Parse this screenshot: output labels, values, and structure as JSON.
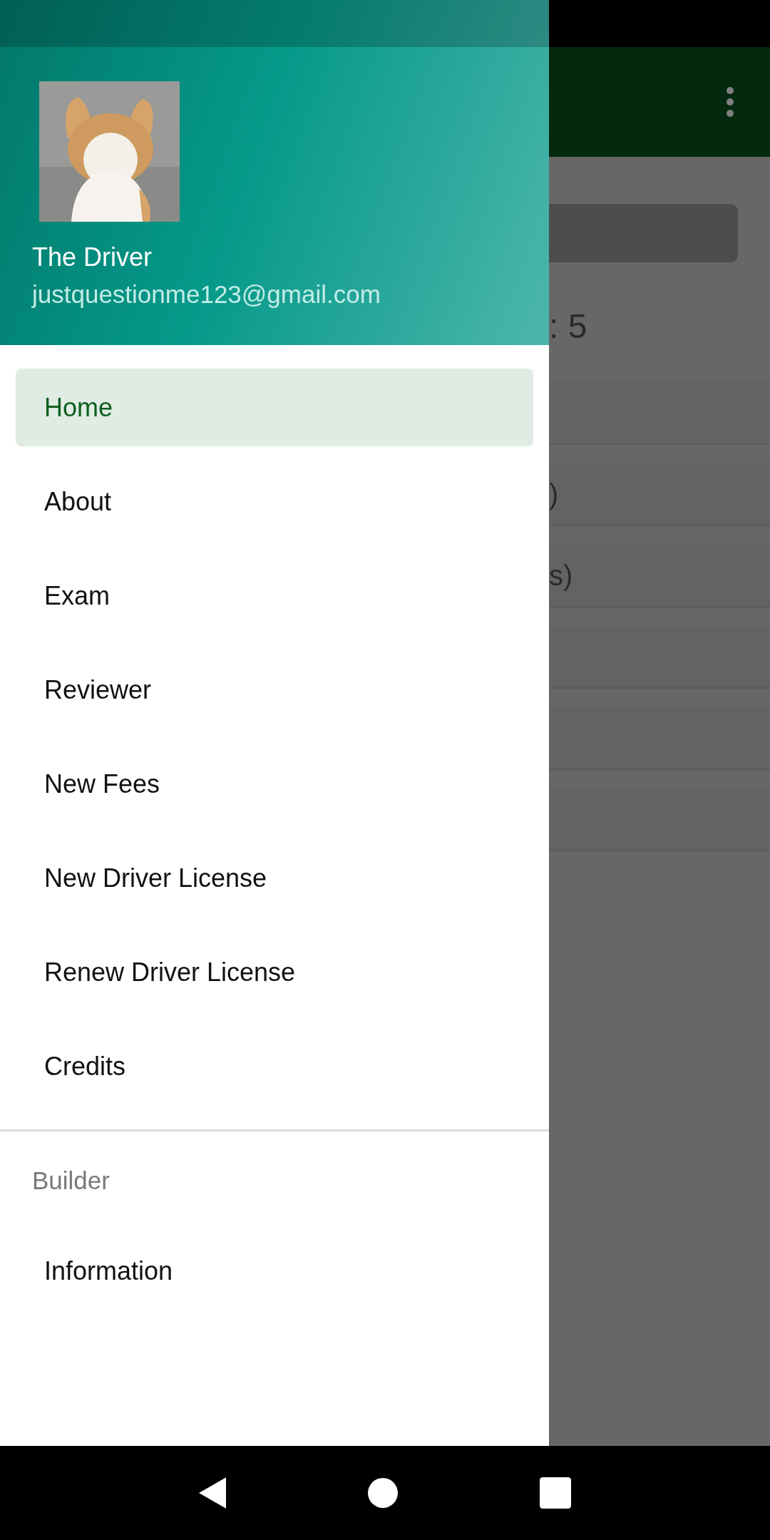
{
  "background": {
    "count_text": ": 5",
    "rows": [
      {
        "kind": "blank"
      },
      {
        "kind": "text",
        "text": ")"
      },
      {
        "kind": "text",
        "text": "s)"
      },
      {
        "kind": "blank"
      },
      {
        "kind": "blank"
      },
      {
        "kind": "blank"
      }
    ]
  },
  "drawer": {
    "header": {
      "name": "The Driver",
      "email": "justquestionme123@gmail.com"
    },
    "items": [
      {
        "label": "Home",
        "selected": true
      },
      {
        "label": "About",
        "selected": false
      },
      {
        "label": "Exam",
        "selected": false
      },
      {
        "label": "Reviewer",
        "selected": false
      },
      {
        "label": "New Fees",
        "selected": false
      },
      {
        "label": "New Driver License",
        "selected": false
      },
      {
        "label": "Renew Driver License",
        "selected": false
      },
      {
        "label": "Credits",
        "selected": false
      }
    ],
    "sections": [
      {
        "title": "Builder",
        "items": [
          {
            "label": "Information",
            "selected": false
          }
        ]
      }
    ]
  }
}
